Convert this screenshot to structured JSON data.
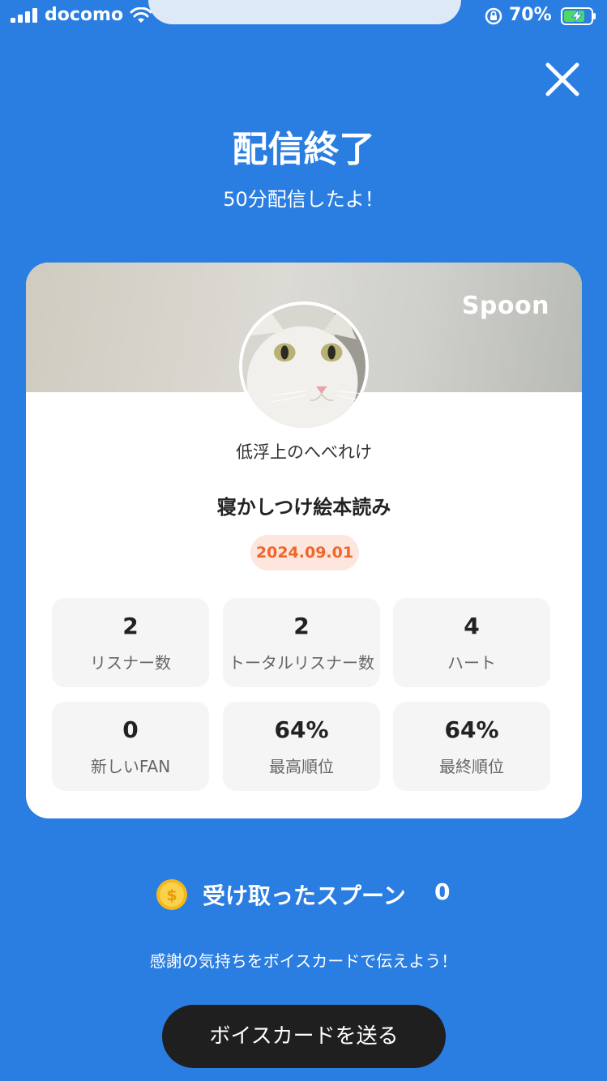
{
  "status_bar": {
    "carrier": "docomo",
    "battery_percent": "70%"
  },
  "header": {
    "title": "配信終了",
    "subtitle": "50分配信したよ！"
  },
  "card": {
    "brand": "Spoon",
    "username": "低浮上のへべれけ",
    "live_title": "寝かしつけ絵本読み",
    "date": "2024.09.01",
    "stats": [
      {
        "value": "2",
        "label": "リスナー数"
      },
      {
        "value": "2",
        "label": "トータルリスナー数"
      },
      {
        "value": "4",
        "label": "ハート"
      },
      {
        "value": "0",
        "label": "新しいFAN"
      },
      {
        "value": "64%",
        "label": "最高順位"
      },
      {
        "value": "64%",
        "label": "最終順位"
      }
    ]
  },
  "spoons": {
    "label": "受け取ったスプーン",
    "count": "0"
  },
  "thanks_message": "感謝の気持ちをボイスカードで伝えよう！",
  "send_button_label": "ボイスカードを送る",
  "colors": {
    "background": "#2a7de1",
    "date_badge_text": "#f0652a",
    "button": "#1f1f1f"
  }
}
